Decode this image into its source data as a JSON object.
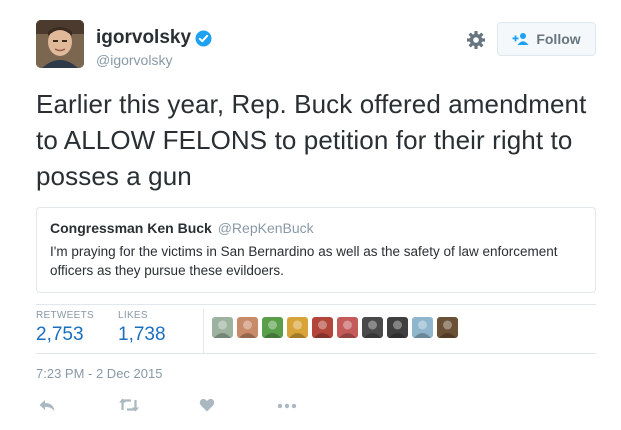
{
  "author": {
    "name": "igorvolsky",
    "handle": "@igorvolsky",
    "verified": true,
    "avatar_icon": "profile-photo-icon"
  },
  "header": {
    "follow_label": "Follow",
    "follow_icon": "add-person-icon",
    "settings_icon": "gear-icon"
  },
  "tweet": {
    "text": "Earlier this year, Rep. Buck offered amendment to ALLOW FELONS to petition for their right to posses a gun"
  },
  "quoted_tweet": {
    "name": "Congressman Ken Buck",
    "handle": "@RepKenBuck",
    "text": "I'm praying for the victims in San Bernardino as well as the safety of law enforcement officers as they pursue these evildoers."
  },
  "stats": {
    "retweets_label": "RETWEETS",
    "retweets_value": "2,753",
    "likes_label": "LIKES",
    "likes_value": "1,738"
  },
  "likers": [
    {
      "icon": "liker-avatar-icon",
      "color": "#9db3a0"
    },
    {
      "icon": "liker-avatar-icon",
      "color": "#c98a6a"
    },
    {
      "icon": "liker-avatar-icon",
      "color": "#5a9e4a"
    },
    {
      "icon": "liker-avatar-icon",
      "color": "#d9a437"
    },
    {
      "icon": "liker-avatar-icon",
      "color": "#b2463a"
    },
    {
      "icon": "liker-avatar-icon",
      "color": "#c45a5a"
    },
    {
      "icon": "liker-avatar-icon",
      "color": "#4a4a4a"
    },
    {
      "icon": "liker-avatar-icon",
      "color": "#3f3f3f"
    },
    {
      "icon": "liker-avatar-icon",
      "color": "#8fb6cc"
    },
    {
      "icon": "liker-avatar-icon",
      "color": "#6a5136"
    }
  ],
  "timestamp": "7:23 PM - 2 Dec 2015",
  "actions": [
    "reply-icon",
    "retweet-icon",
    "like-icon",
    "more-icon"
  ],
  "colors": {
    "link_blue": "#1b6fbf",
    "verified_blue": "#1da1f2",
    "muted": "#8899a6",
    "border": "#e1e8ed"
  }
}
